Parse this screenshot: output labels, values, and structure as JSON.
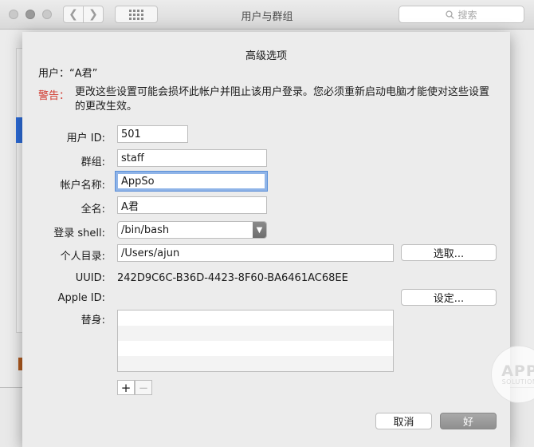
{
  "window": {
    "title": "用户与群组",
    "search_placeholder": "搜索"
  },
  "sheet": {
    "title": "高级选项",
    "user_line": "用户：“A君”",
    "warning_label": "警告：",
    "warning_text": "更改这些设置可能会损坏此帐户并阻止该用户登录。您必须重新启动电脑才能使对这些设置的更改生效。",
    "fields": {
      "user_id_label": "用户 ID:",
      "user_id_value": "501",
      "group_label": "群组:",
      "group_value": "staff",
      "account_name_label": "帐户名称:",
      "account_name_value": "AppSo",
      "full_name_label": "全名:",
      "full_name_value": "A君",
      "login_shell_label": "登录 shell:",
      "login_shell_value": "/bin/bash",
      "home_dir_label": "个人目录:",
      "home_dir_value": "/Users/ajun",
      "uuid_label": "UUID:",
      "uuid_value": "242D9C6C-B36D-4423-8F60-BA6461AC68EE",
      "apple_id_label": "Apple ID:",
      "aliases_label": "替身:"
    },
    "buttons": {
      "choose": "选取...",
      "set": "设定...",
      "add": "+",
      "remove": "−",
      "cancel": "取消",
      "ok": "好"
    }
  },
  "watermark": {
    "big": "APP",
    "small": "SOLUTION"
  },
  "colors": {
    "warning": "#d0362b",
    "focus_ring": "#8fb4e8",
    "sidebar_selection": "#2c6bd8"
  }
}
